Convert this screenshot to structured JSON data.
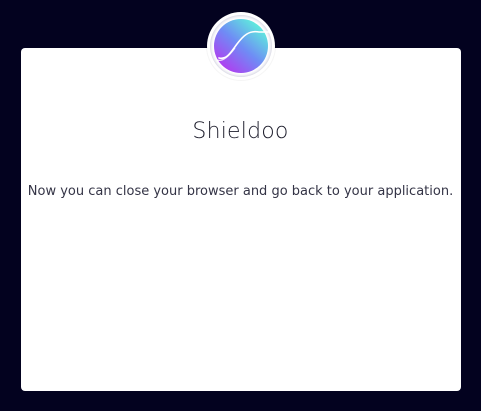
{
  "app": {
    "title": "Shieldoo",
    "logo_icon": "shieldoo-logo-icon"
  },
  "content": {
    "message": "Now you can close your browser and go back to your application."
  },
  "colors": {
    "background": "#03021f",
    "card": "#ffffff",
    "logo_gradient_start": "#5ef0dc",
    "logo_gradient_mid": "#6f8cf5",
    "logo_gradient_end": "#b13cf0"
  }
}
